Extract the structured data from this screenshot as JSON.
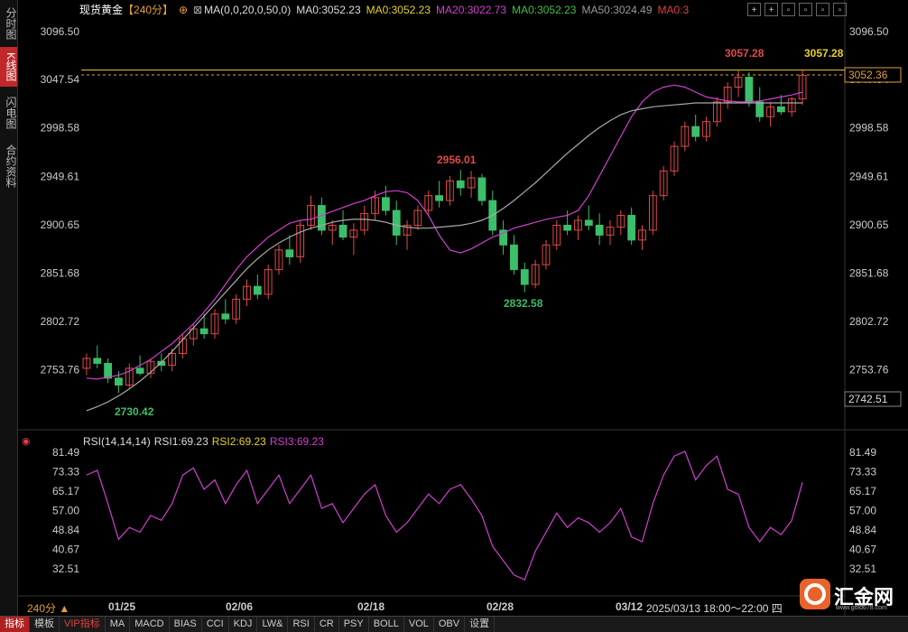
{
  "left_tabs": [
    "分时图",
    "K线图",
    "闪电图",
    "合约资料"
  ],
  "header": {
    "symbol": "现货黄金",
    "period": "【240分】",
    "ma_params": "MA(0,0,20,0,50,0)",
    "ma_items": [
      {
        "label": "MA0:3052.23",
        "color": "#dddddd"
      },
      {
        "label": "MA0:3052.23",
        "color": "#e6d02a"
      },
      {
        "label": "MA20:3022.73",
        "color": "#d040d0"
      },
      {
        "label": "MA0:3052.23",
        "color": "#40c040"
      },
      {
        "label": "MA50:3024.49",
        "color": "#999999"
      },
      {
        "label": "MA0:3",
        "color": "#e04040"
      }
    ]
  },
  "window_buttons": [
    "+",
    "+",
    "▫",
    "▫",
    "▫",
    "▫"
  ],
  "price_axis": {
    "ticks": [
      "3096.50",
      "3047.54",
      "2998.58",
      "2949.61",
      "2900.65",
      "2851.68",
      "2802.72",
      "2753.76"
    ],
    "tick_values": [
      3096.5,
      3047.54,
      2998.58,
      2949.61,
      2900.65,
      2851.68,
      2802.72,
      2753.76
    ],
    "current_price": "3052.36",
    "low_box": "2742.51",
    "high_line": "3057.28"
  },
  "annotations": {
    "high_right": "3057.28",
    "high_mid": "3057.28",
    "peak_feb": "2956.01",
    "low_feb": "2832.58",
    "low_jan": "2730.42"
  },
  "rsi": {
    "title": "RSI(14,14,14)",
    "rsi1": "RSI1:69.23",
    "rsi2": "RSI2:69.23",
    "rsi3": "RSI3:69.23",
    "ticks": [
      "81.49",
      "73.33",
      "65.17",
      "57.00",
      "48.84",
      "40.67",
      "32.51"
    ],
    "tick_values": [
      81.49,
      73.33,
      65.17,
      57.0,
      48.84,
      40.67,
      32.51
    ]
  },
  "x_axis": {
    "period_label": "240分",
    "dates": [
      "01/25",
      "02/06",
      "02/18",
      "02/28",
      "03/12"
    ],
    "datetime": "2025/03/13 18:00～22:00 四"
  },
  "bottom_tabs": [
    "指标",
    "模板",
    "VIP指标",
    "MA",
    "MACD",
    "BIAS",
    "CCI",
    "KDJ",
    "LW&",
    "RSI",
    "CR",
    "PSY",
    "BOLL",
    "VOL",
    "OBV",
    "设置"
  ],
  "logo": {
    "name": "汇金网",
    "url": "www.gold678.com"
  },
  "colors": {
    "up": "#e04a4a",
    "down": "#3bbf6a",
    "ma20": "#d040d0",
    "ma50": "#aaaaaa",
    "rsi": "#d040d0",
    "hline": "#e6d02a"
  },
  "chart_data": {
    "type": "candlestick",
    "price_range": [
      2700,
      3110
    ],
    "rsi_range": [
      25,
      85
    ],
    "bars": [
      [
        2755,
        2770,
        2748,
        2765
      ],
      [
        2765,
        2778,
        2755,
        2760
      ],
      [
        2760,
        2765,
        2740,
        2745
      ],
      [
        2745,
        2752,
        2730,
        2738
      ],
      [
        2738,
        2760,
        2735,
        2755
      ],
      [
        2755,
        2768,
        2748,
        2750
      ],
      [
        2750,
        2765,
        2745,
        2762
      ],
      [
        2762,
        2770,
        2752,
        2758
      ],
      [
        2758,
        2775,
        2752,
        2770
      ],
      [
        2770,
        2790,
        2765,
        2785
      ],
      [
        2785,
        2800,
        2778,
        2795
      ],
      [
        2795,
        2810,
        2785,
        2790
      ],
      [
        2790,
        2815,
        2785,
        2810
      ],
      [
        2810,
        2825,
        2800,
        2805
      ],
      [
        2805,
        2830,
        2800,
        2825
      ],
      [
        2825,
        2845,
        2818,
        2838
      ],
      [
        2838,
        2850,
        2825,
        2830
      ],
      [
        2830,
        2860,
        2825,
        2855
      ],
      [
        2855,
        2880,
        2850,
        2875
      ],
      [
        2875,
        2890,
        2860,
        2868
      ],
      [
        2868,
        2905,
        2862,
        2900
      ],
      [
        2900,
        2930,
        2895,
        2920
      ],
      [
        2920,
        2928,
        2890,
        2895
      ],
      [
        2895,
        2905,
        2880,
        2900
      ],
      [
        2900,
        2915,
        2885,
        2888
      ],
      [
        2888,
        2902,
        2870,
        2895
      ],
      [
        2895,
        2920,
        2890,
        2912
      ],
      [
        2912,
        2935,
        2905,
        2928
      ],
      [
        2928,
        2940,
        2910,
        2915
      ],
      [
        2915,
        2925,
        2880,
        2890
      ],
      [
        2890,
        2905,
        2875,
        2900
      ],
      [
        2900,
        2920,
        2895,
        2915
      ],
      [
        2915,
        2935,
        2910,
        2930
      ],
      [
        2930,
        2945,
        2918,
        2925
      ],
      [
        2925,
        2950,
        2920,
        2945
      ],
      [
        2945,
        2956,
        2930,
        2938
      ],
      [
        2938,
        2955,
        2928,
        2948
      ],
      [
        2948,
        2952,
        2920,
        2925
      ],
      [
        2925,
        2935,
        2890,
        2895
      ],
      [
        2895,
        2905,
        2870,
        2880
      ],
      [
        2880,
        2890,
        2850,
        2855
      ],
      [
        2855,
        2862,
        2832,
        2840
      ],
      [
        2840,
        2865,
        2836,
        2860
      ],
      [
        2860,
        2885,
        2855,
        2880
      ],
      [
        2880,
        2905,
        2875,
        2900
      ],
      [
        2900,
        2915,
        2890,
        2895
      ],
      [
        2895,
        2910,
        2885,
        2905
      ],
      [
        2905,
        2920,
        2895,
        2900
      ],
      [
        2900,
        2912,
        2880,
        2890
      ],
      [
        2890,
        2905,
        2880,
        2898
      ],
      [
        2898,
        2915,
        2890,
        2910
      ],
      [
        2910,
        2918,
        2880,
        2885
      ],
      [
        2885,
        2900,
        2875,
        2895
      ],
      [
        2895,
        2935,
        2890,
        2930
      ],
      [
        2930,
        2960,
        2925,
        2955
      ],
      [
        2955,
        2985,
        2950,
        2980
      ],
      [
        2980,
        3005,
        2975,
        3000
      ],
      [
        3000,
        3012,
        2985,
        2990
      ],
      [
        2990,
        3010,
        2985,
        3005
      ],
      [
        3005,
        3030,
        3000,
        3025
      ],
      [
        3025,
        3045,
        3018,
        3040
      ],
      [
        3040,
        3057,
        3030,
        3050
      ],
      [
        3050,
        3055,
        3020,
        3025
      ],
      [
        3025,
        3040,
        3005,
        3010
      ],
      [
        3010,
        3025,
        3000,
        3020
      ],
      [
        3020,
        3032,
        3012,
        3015
      ],
      [
        3015,
        3030,
        3010,
        3028
      ],
      [
        3028,
        3057,
        3022,
        3052
      ]
    ],
    "rsi_values": [
      72,
      74,
      60,
      45,
      50,
      48,
      55,
      53,
      60,
      72,
      75,
      66,
      70,
      60,
      68,
      74,
      60,
      66,
      72,
      60,
      66,
      72,
      58,
      60,
      52,
      58,
      64,
      68,
      55,
      48,
      52,
      58,
      64,
      60,
      66,
      68,
      62,
      55,
      42,
      36,
      30,
      28,
      40,
      48,
      56,
      50,
      54,
      52,
      48,
      52,
      58,
      46,
      44,
      60,
      72,
      80,
      82,
      70,
      76,
      80,
      66,
      64,
      50,
      44,
      50,
      47,
      53,
      69
    ],
    "ma20": [
      2745,
      2744,
      2746,
      2748,
      2752,
      2758,
      2764,
      2772,
      2780,
      2790,
      2800,
      2812,
      2825,
      2840,
      2855,
      2868,
      2878,
      2888,
      2895,
      2902,
      2905,
      2906,
      2910,
      2914,
      2918,
      2922,
      2925,
      2930,
      2934,
      2935,
      2933,
      2925,
      2910,
      2890,
      2875,
      2872,
      2876,
      2882,
      2888,
      2892,
      2897,
      2900,
      2903,
      2906,
      2908,
      2910,
      2915,
      2930,
      2950,
      2970,
      2990,
      3010,
      3025,
      3035,
      3040,
      3042,
      3040,
      3035,
      3030,
      3028,
      3026,
      3025,
      3025,
      3026,
      3028,
      3030,
      3032,
      3035
    ],
    "ma50": [
      2712,
      2716,
      2721,
      2727,
      2734,
      2742,
      2751,
      2761,
      2772,
      2784,
      2796,
      2808,
      2820,
      2832,
      2844,
      2856,
      2866,
      2875,
      2882,
      2888,
      2893,
      2897,
      2900,
      2903,
      2905,
      2906,
      2906,
      2905,
      2903,
      2900,
      2898,
      2897,
      2897,
      2898,
      2899,
      2900,
      2902,
      2905,
      2910,
      2917,
      2925,
      2934,
      2943,
      2953,
      2963,
      2973,
      2982,
      2991,
      2999,
      3006,
      3012,
      3016,
      3018,
      3020,
      3021,
      3022,
      3023,
      3024,
      3024,
      3024,
      3024,
      3024,
      3024,
      3024,
      3024,
      3024,
      3024,
      3024
    ]
  }
}
